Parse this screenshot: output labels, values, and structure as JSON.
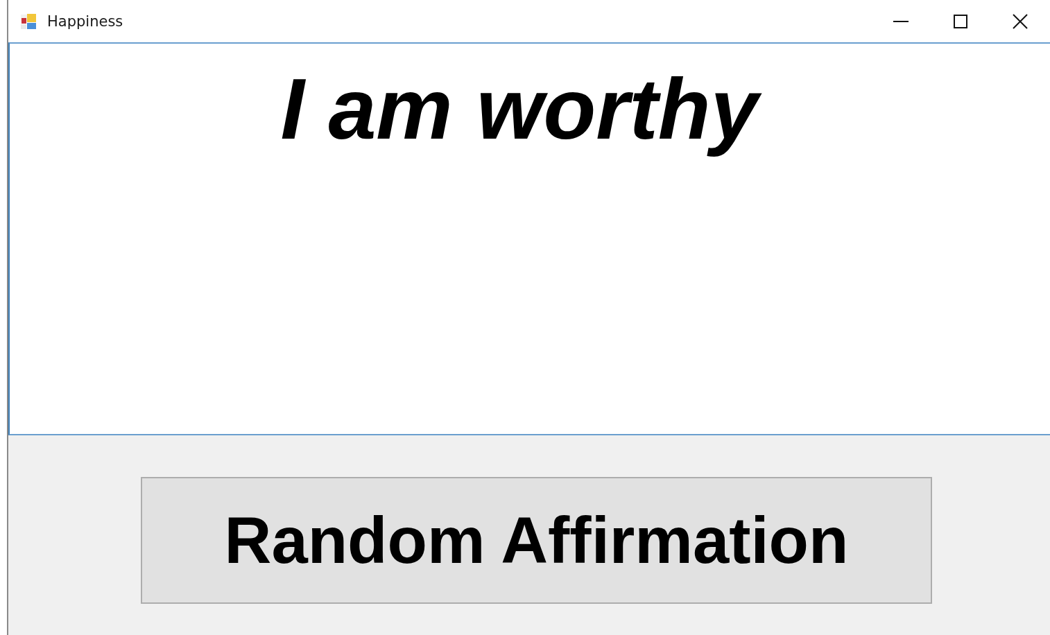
{
  "window": {
    "title": "Happiness"
  },
  "affirmation_box": {
    "value": "I am worthy"
  },
  "buttons": [
    {
      "label": "Random Affirmation"
    }
  ]
}
